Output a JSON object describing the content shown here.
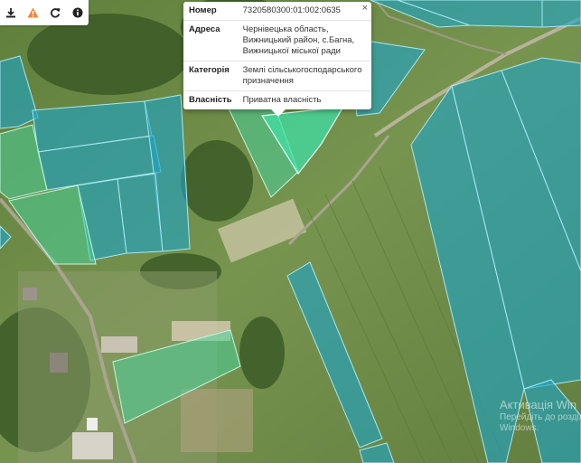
{
  "toolbar": {
    "tools": [
      {
        "icon": "download-icon"
      },
      {
        "icon": "warning-icon",
        "color": "#f0883a"
      },
      {
        "icon": "refresh-icon"
      },
      {
        "icon": "info-icon"
      }
    ]
  },
  "popup": {
    "close_label": "×",
    "rows": [
      {
        "key": "Номер",
        "value": "7320580300:01:002:0635"
      },
      {
        "key": "Адреса",
        "value": "Чернівецька область, Вижницький район, с.Багна, Вижницької міської ради"
      },
      {
        "key": "Категорія",
        "value": "Землі сільськогосподарського призначення"
      },
      {
        "key": "Власність",
        "value": "Приватна власність"
      }
    ]
  },
  "watermark": {
    "title": "Активація Win",
    "line1": "Перейдіть до розділ",
    "line2": "Windows."
  },
  "colors": {
    "parcel_blue": "#1fa3c3",
    "parcel_green": "#45d6a0",
    "parcel_selected": "#3fe0a8",
    "imagery_base": "#6e8f4a"
  }
}
